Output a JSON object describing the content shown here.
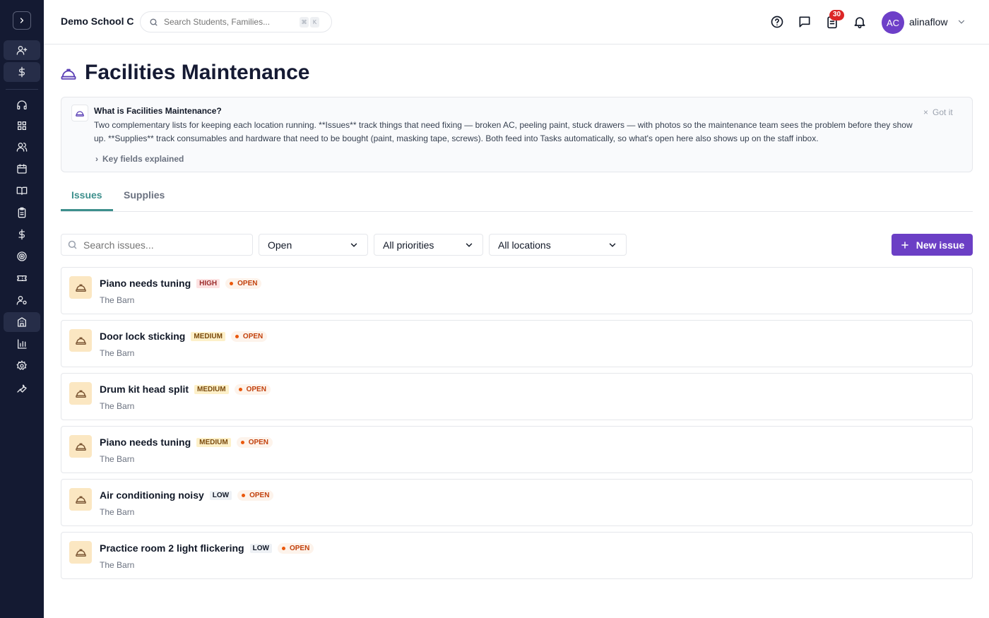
{
  "header": {
    "school_name": "Demo School C",
    "search_placeholder": "Search Students, Families...",
    "kbd_keys": [
      "⌘",
      "K"
    ],
    "notification_count": "30",
    "user_initials": "AC",
    "user_name": "alinaflow"
  },
  "page": {
    "title": "Facilities Maintenance"
  },
  "info": {
    "title": "What is Facilities Maintenance?",
    "body": "Two complementary lists for keeping each location running. **Issues** track things that need fixing — broken AC, peeling paint, stuck drawers — with photos so the maintenance team sees the problem before they show up. **Supplies** track consumables and hardware that need to be bought (paint, masking tape, screws). Both feed into Tasks automatically, so what's open here also shows up on the staff inbox.",
    "dismiss_label": "Got it",
    "key_fields_label": "Key fields explained"
  },
  "tabs": [
    {
      "label": "Issues",
      "active": true
    },
    {
      "label": "Supplies",
      "active": false
    }
  ],
  "filters": {
    "search_placeholder": "Search issues...",
    "status": "Open",
    "priority": "All priorities",
    "location": "All locations",
    "new_label": "New issue"
  },
  "issues": [
    {
      "title": "Piano needs tuning",
      "priority": "HIGH",
      "status": "OPEN",
      "location": "The Barn"
    },
    {
      "title": "Door lock sticking",
      "priority": "MEDIUM",
      "status": "OPEN",
      "location": "The Barn"
    },
    {
      "title": "Drum kit head split",
      "priority": "MEDIUM",
      "status": "OPEN",
      "location": "The Barn"
    },
    {
      "title": "Piano needs tuning",
      "priority": "MEDIUM",
      "status": "OPEN",
      "location": "The Barn"
    },
    {
      "title": "Air conditioning noisy",
      "priority": "LOW",
      "status": "OPEN",
      "location": "The Barn"
    },
    {
      "title": "Practice room 2 light flickering",
      "priority": "LOW",
      "status": "OPEN",
      "location": "The Barn"
    }
  ],
  "colors": {
    "sidebar": "#141a32",
    "accent_purple": "#6b3fc5",
    "tab_active": "#3d8f8c",
    "status_orange": "#c2410c"
  }
}
